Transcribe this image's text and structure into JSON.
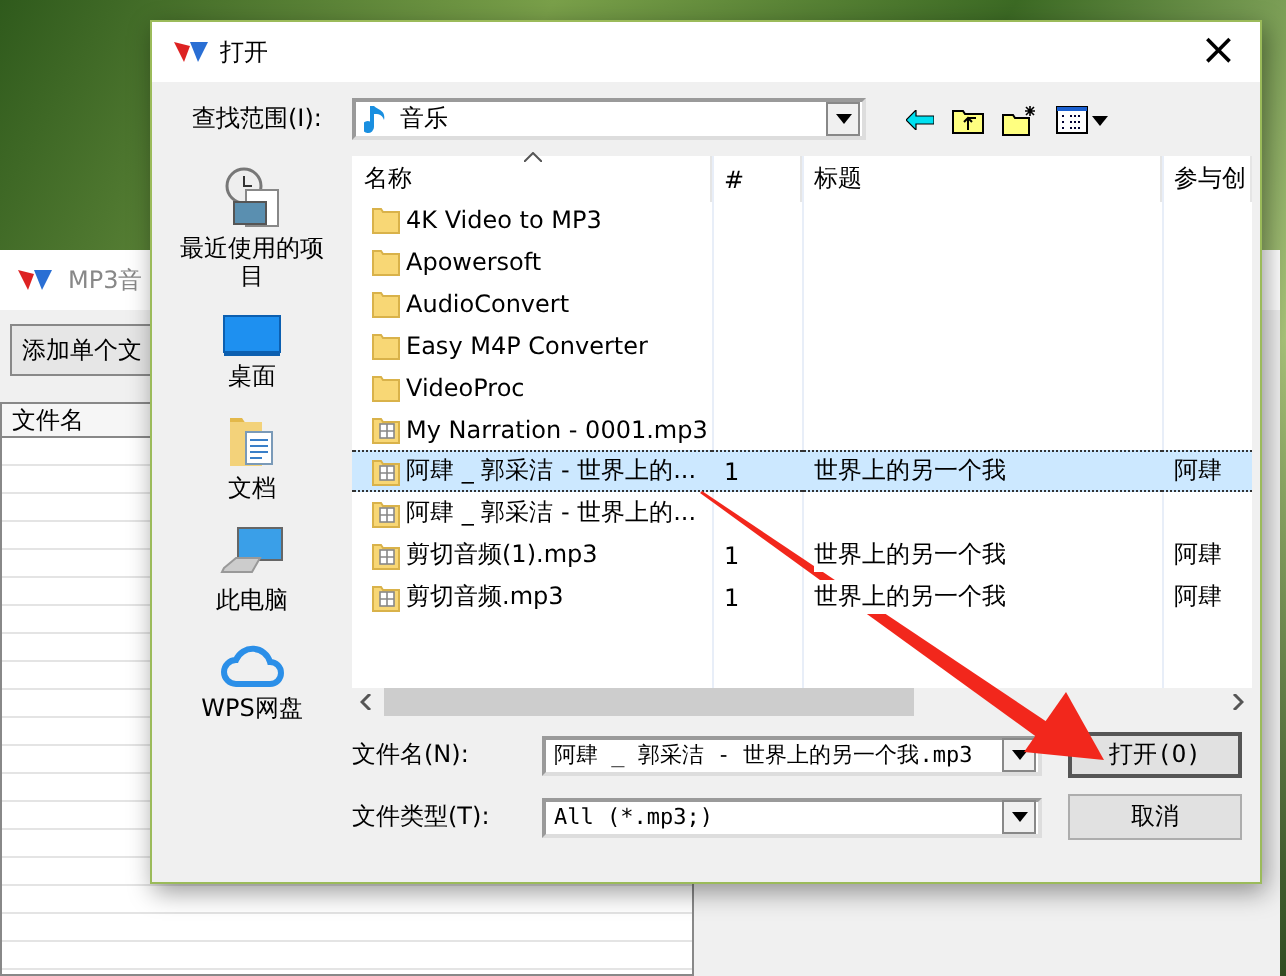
{
  "background_app": {
    "title": "MP3音",
    "buttons": [
      "添加单个文"
    ],
    "columns": [
      "文件名"
    ]
  },
  "dialog": {
    "title": "打开",
    "close": "×",
    "look_in": {
      "label": "查找范围(I):",
      "value": "音乐"
    },
    "places": [
      {
        "kind": "recent",
        "label": "最近使用的项目"
      },
      {
        "kind": "desktop",
        "label": "桌面"
      },
      {
        "kind": "documents",
        "label": "文档"
      },
      {
        "kind": "computer",
        "label": "此电脑"
      },
      {
        "kind": "cloud",
        "label": "WPS网盘"
      }
    ],
    "file_list": {
      "columns": [
        "名称",
        "#",
        "标题",
        "参与创"
      ],
      "rows": [
        {
          "kind": "folder",
          "selected": false,
          "cells": [
            "4K Video to MP3"
          ]
        },
        {
          "kind": "folder",
          "selected": false,
          "cells": [
            "Apowersoft"
          ]
        },
        {
          "kind": "folder",
          "selected": false,
          "cells": [
            "AudioConvert"
          ]
        },
        {
          "kind": "folder",
          "selected": false,
          "cells": [
            "Easy M4P Converter"
          ]
        },
        {
          "kind": "folder",
          "selected": false,
          "cells": [
            "VideoProc"
          ]
        },
        {
          "kind": "file",
          "selected": false,
          "cells": [
            "My Narration - 0001.mp3"
          ]
        },
        {
          "kind": "file",
          "selected": true,
          "cells": [
            "阿肆 _ 郭采洁 - 世界上的...",
            "1",
            "世界上的另一个我",
            "阿肆"
          ]
        },
        {
          "kind": "file",
          "selected": false,
          "cells": [
            "阿肆 _ 郭采洁 - 世界上的..."
          ]
        },
        {
          "kind": "file",
          "selected": false,
          "cells": [
            "剪切音频(1).mp3",
            "1",
            "世界上的另一个我",
            "阿肆"
          ]
        },
        {
          "kind": "file",
          "selected": false,
          "cells": [
            "剪切音频.mp3",
            "1",
            "世界上的另一个我",
            "阿肆"
          ]
        }
      ]
    },
    "file_name": {
      "label": "文件名(N):",
      "value": "阿肆 _ 郭采洁 - 世界上的另一个我.mp3"
    },
    "file_type": {
      "label": "文件类型(T):",
      "value": "All (*.mp3;)"
    },
    "buttons": [
      {
        "label": "打开(O)",
        "default": true
      },
      {
        "label": "取消",
        "default": false
      }
    ]
  }
}
